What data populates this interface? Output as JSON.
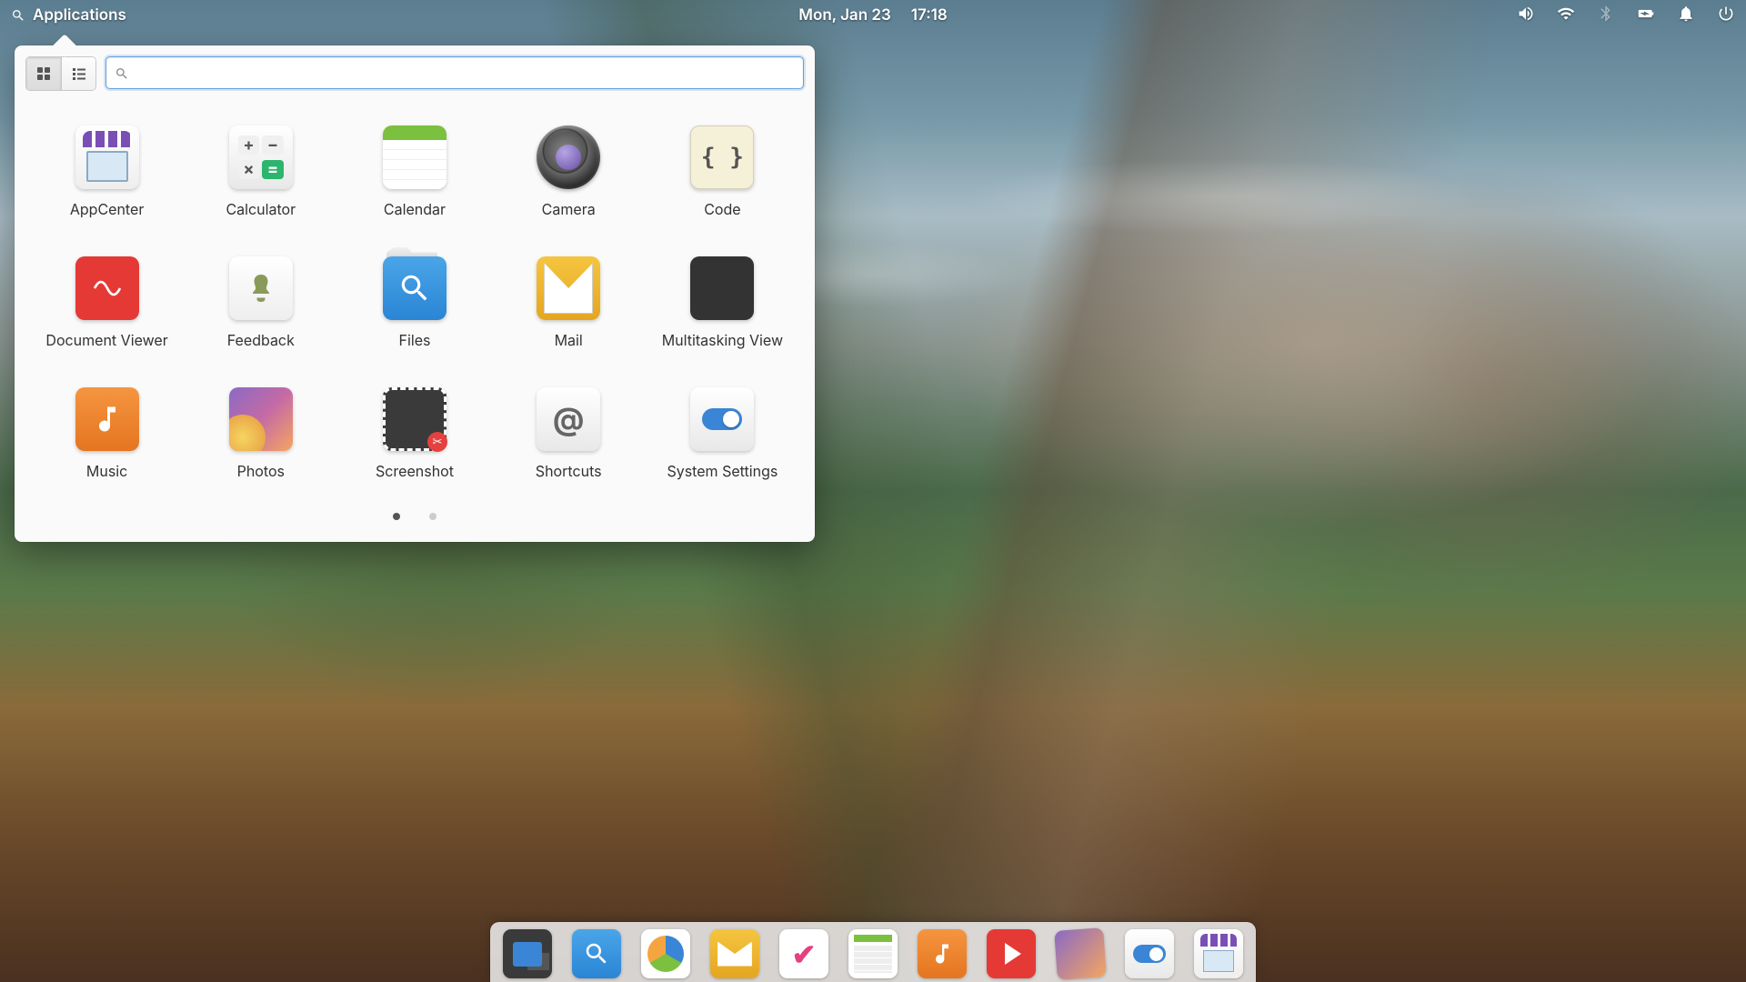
{
  "panel": {
    "applications_label": "Applications",
    "date": "Mon, Jan 23",
    "time": "17:18"
  },
  "menu": {
    "search_placeholder": "",
    "apps": [
      {
        "label": "AppCenter"
      },
      {
        "label": "Calculator"
      },
      {
        "label": "Calendar"
      },
      {
        "label": "Camera"
      },
      {
        "label": "Code"
      },
      {
        "label": "Document Viewer"
      },
      {
        "label": "Feedback"
      },
      {
        "label": "Files"
      },
      {
        "label": "Mail"
      },
      {
        "label": "Multitasking View"
      },
      {
        "label": "Music"
      },
      {
        "label": "Photos"
      },
      {
        "label": "Screenshot"
      },
      {
        "label": "Shortcuts"
      },
      {
        "label": "System Settings"
      }
    ],
    "code_glyph": "{ }",
    "shortcut_glyph": "@",
    "calc": {
      "plus": "+",
      "minus": "−",
      "times": "×",
      "equals": "="
    },
    "pages": 2,
    "active_page": 1
  },
  "dock": {
    "items": [
      {
        "name": "multitasking"
      },
      {
        "name": "files"
      },
      {
        "name": "web"
      },
      {
        "name": "mail"
      },
      {
        "name": "tasks"
      },
      {
        "name": "calendar"
      },
      {
        "name": "music"
      },
      {
        "name": "videos"
      },
      {
        "name": "photos"
      },
      {
        "name": "settings"
      },
      {
        "name": "appcenter"
      }
    ]
  }
}
